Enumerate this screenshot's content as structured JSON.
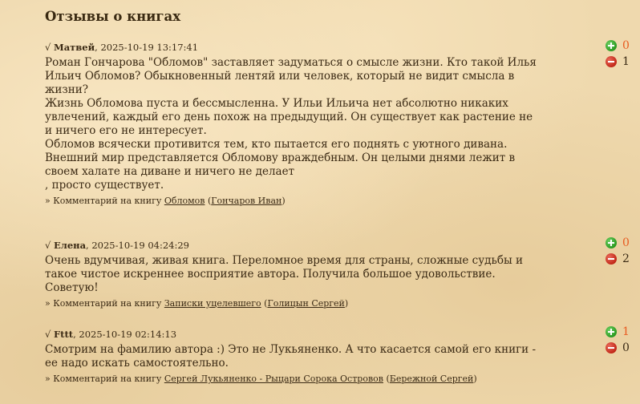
{
  "page": {
    "title": "Отзывы о книгах"
  },
  "labels": {
    "check": "√",
    "comment_prefix": "» Комментарий на книгу"
  },
  "reviews": [
    {
      "author": "Матвей",
      "date": ", 2025-10-19 13:17:41",
      "paragraphs": [
        "Роман Гончарова \"Обломов\" заставляет задуматься о смысле жизни. Кто такой Илья Ильич Обломов? Обыкновенный лентяй или человек, который не видит смысла в жизни?",
        "Жизнь Обломова пуста и бессмысленна. У Ильи Ильича нет абсолютно никаких увлечений, каждый его день похож на предыдущий. Он существует как растение не и ничего его не интересует.",
        "Обломов всячески противится тем, кто пытается его поднять с уютного дивана.",
        "Внешний мир представляется Обломову враждебным. Он целыми днями лежит в своем халате на диване и ничего не делает",
        ", просто существует."
      ],
      "book": "Обломов",
      "book_author": "Гончаров Иван",
      "votes_plus": "0",
      "votes_minus": "1"
    },
    {
      "author": "Елена",
      "date": ", 2025-10-19 04:24:29",
      "paragraphs": [
        "Очень вдумчивая, живая книга. Переломное время для страны, сложные судьбы и такое чистое искреннее восприятие автора. Получила большое удовольствие. Советую!"
      ],
      "book": "Записки уцелевшего",
      "book_author": "Голицын Сергей",
      "votes_plus": "0",
      "votes_minus": "2"
    },
    {
      "author": "Fttt",
      "date": ", 2025-10-19 02:14:13",
      "paragraphs": [
        "Смотрим на фамилию автора :) Это не Лукьяненко. А что касается самой его книги - ее надо искать самостоятельно."
      ],
      "book": "Сергей Лукьяненко - Рыцари Сорока Островов",
      "book_author": "Бережной Сергей",
      "votes_plus": "1",
      "votes_minus": "0"
    }
  ]
}
